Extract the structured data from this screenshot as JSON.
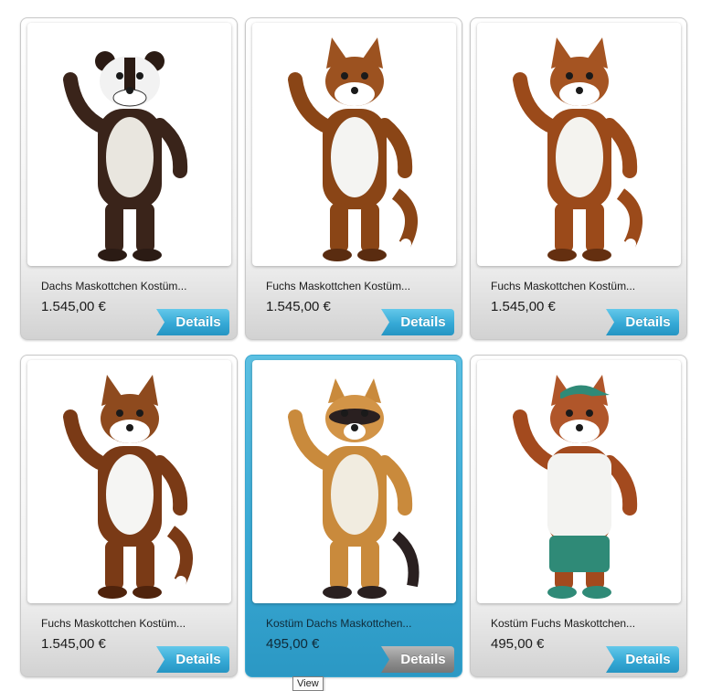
{
  "products": [
    {
      "title": "Dachs Maskottchen Kostüm...",
      "price": "1.545,00 €",
      "details_label": "Details",
      "image_icon": "badger-mascot-costume",
      "colors": {
        "fur": "#3a241a",
        "belly": "#e9e6df",
        "face": "#f2f2f2",
        "accent": "#2b1b14"
      }
    },
    {
      "title": "Fuchs Maskottchen Kostüm...",
      "price": "1.545,00 €",
      "details_label": "Details",
      "image_icon": "fox-mascot-costume",
      "colors": {
        "fur": "#8a4516",
        "belly": "#f4f4f2",
        "face": "#9c5220",
        "accent": "#5a2c10"
      }
    },
    {
      "title": "Fuchs Maskottchen Kostüm...",
      "price": "1.545,00 €",
      "details_label": "Details",
      "image_icon": "fox-mascot-costume",
      "colors": {
        "fur": "#9b4a1a",
        "belly": "#f4f3ef",
        "face": "#a55422",
        "accent": "#642f10"
      }
    },
    {
      "title": "Fuchs Maskottchen Kostüm...",
      "price": "1.545,00 €",
      "details_label": "Details",
      "image_icon": "fox-mascot-costume",
      "colors": {
        "fur": "#7a3a16",
        "belly": "#f5f5f3",
        "face": "#8e4a1e",
        "accent": "#4f230c"
      }
    },
    {
      "title": "Kostüm Dachs Maskottchen...",
      "price": "495,00 €",
      "details_label": "Details",
      "image_icon": "raccoon-mascot-costume",
      "colors": {
        "fur": "#c98a3c",
        "belly": "#f1ece0",
        "face": "#d29447",
        "accent": "#2a2020"
      }
    },
    {
      "title": "Kostüm Fuchs Maskottchen...",
      "price": "495,00 €",
      "details_label": "Details",
      "image_icon": "fox-sport-mascot-costume",
      "colors": {
        "fur": "#a34a1e",
        "belly": "#f3f3f1",
        "face": "#b0562a",
        "accent": "#2f8a77"
      }
    }
  ],
  "active_index": 4,
  "tooltip": "View"
}
